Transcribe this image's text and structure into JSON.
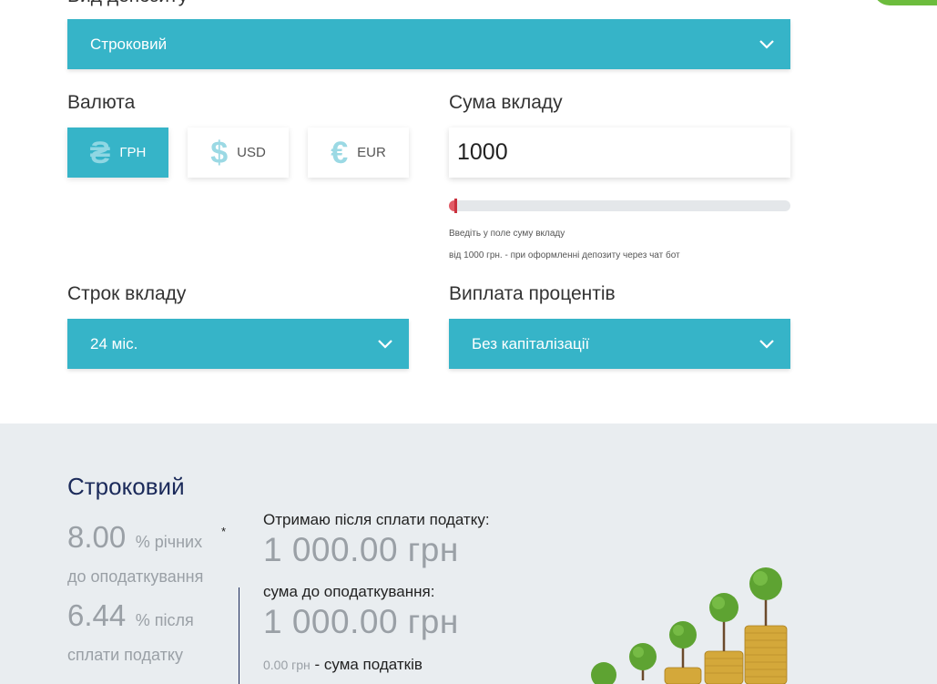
{
  "deposit_type": {
    "label": "Вид депозиту",
    "selected": "Строковий"
  },
  "currency": {
    "label": "Валюта",
    "options": [
      {
        "symbol": "₴",
        "code": "ГРН",
        "active": true
      },
      {
        "symbol": "$",
        "code": "USD",
        "active": false
      },
      {
        "symbol": "€",
        "code": "EUR",
        "active": false
      }
    ]
  },
  "amount": {
    "label": "Сума вкладу",
    "value": "1000",
    "slider_fraction": 0.02,
    "hint": "Введіть у поле суму вкладу",
    "min_note": "від 1000 грн. - при оформленні депозиту через чат бот"
  },
  "term": {
    "label": "Строк вкладу",
    "selected": "24 міс."
  },
  "interest_payment": {
    "label": "Виплата процентів",
    "selected": "Без капіталізації"
  },
  "result": {
    "title": "Строковий",
    "rate_before_tax": "8.00",
    "rate_before_unit": "% річних",
    "rate_before_sub": "до оподаткування",
    "asterisk": "*",
    "rate_after_tax": "6.44",
    "rate_after_unit": "% після",
    "rate_after_sub": "сплати податку",
    "after_tax_label": "Отримаю після сплати податку:",
    "after_tax_value": "1 000.00 грн",
    "before_tax_label": "сума до оподаткування:",
    "before_tax_value": "1 000.00 грн",
    "tax_amount": "0.00 грн",
    "tax_label": "- сума податків"
  },
  "colors": {
    "accent": "#36b4c8",
    "slider_fill": "#e25b66",
    "section_bg": "#e9edf0",
    "title_navy": "#1b2a5a",
    "corner_button": "#6cbc3d"
  }
}
